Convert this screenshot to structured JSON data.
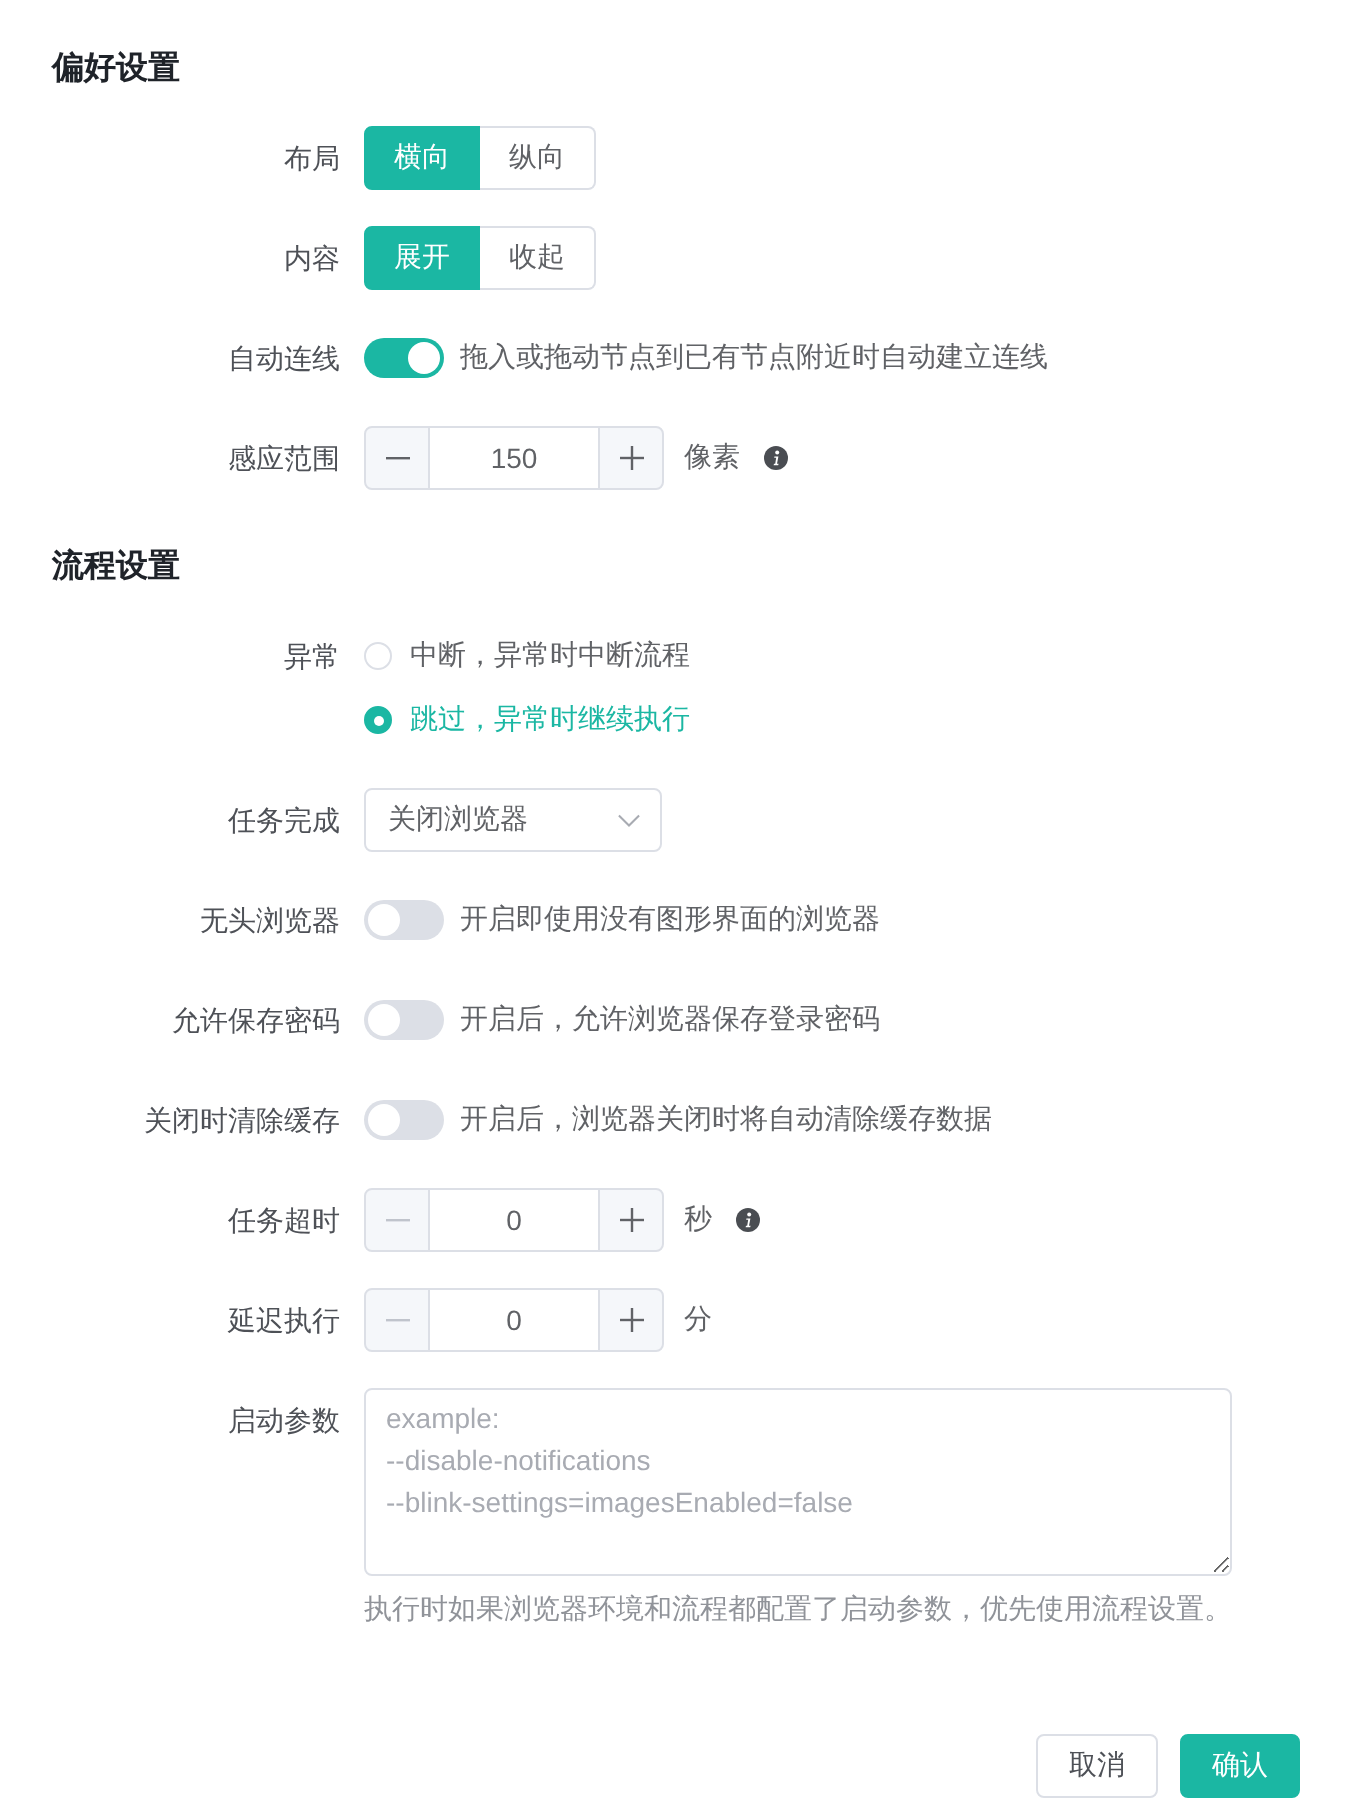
{
  "sections": [
    {
      "title": "偏好设置",
      "fields": [
        {
          "kind": "segmented",
          "label": "布局",
          "options": [
            {
              "label": "横向",
              "selected": true
            },
            {
              "label": "纵向",
              "selected": false
            }
          ]
        },
        {
          "kind": "segmented",
          "label": "内容",
          "options": [
            {
              "label": "展开",
              "selected": true
            },
            {
              "label": "收起",
              "selected": false
            }
          ]
        },
        {
          "kind": "switch",
          "label": "自动连线",
          "on": true,
          "description": "拖入或拖动节点到已有节点附近时自动建立连线"
        },
        {
          "kind": "number",
          "label": "感应范围",
          "value": "150",
          "decrement_disabled": false,
          "unit": "像素",
          "info": true
        }
      ]
    },
    {
      "title": "流程设置",
      "fields": [
        {
          "kind": "radio",
          "label": "异常",
          "options": [
            {
              "label": "中断，异常时中断流程",
              "selected": false
            },
            {
              "label": "跳过，异常时继续执行",
              "selected": true
            }
          ]
        },
        {
          "kind": "select",
          "label": "任务完成",
          "value": "关闭浏览器"
        },
        {
          "kind": "switch",
          "label": "无头浏览器",
          "on": false,
          "description": "开启即使用没有图形界面的浏览器"
        },
        {
          "kind": "switch",
          "label": "允许保存密码",
          "on": false,
          "description": "开启后，允许浏览器保存登录密码"
        },
        {
          "kind": "switch",
          "label": "关闭时清除缓存",
          "on": false,
          "description": "开启后，浏览器关闭时将自动清除缓存数据"
        },
        {
          "kind": "number",
          "label": "任务超时",
          "value": "0",
          "decrement_disabled": true,
          "unit": "秒",
          "info": true
        },
        {
          "kind": "number",
          "label": "延迟执行",
          "value": "0",
          "decrement_disabled": true,
          "unit": "分",
          "info": false
        },
        {
          "kind": "textarea",
          "label": "启动参数",
          "placeholder": "example:\n--disable-notifications\n--blink-settings=imagesEnabled=false",
          "help": "执行时如果浏览器环境和流程都配置了启动参数，优先使用流程设置。"
        }
      ]
    }
  ],
  "buttons": [
    {
      "label": "取消",
      "kind": "default"
    },
    {
      "label": "确认",
      "kind": "primary"
    }
  ]
}
